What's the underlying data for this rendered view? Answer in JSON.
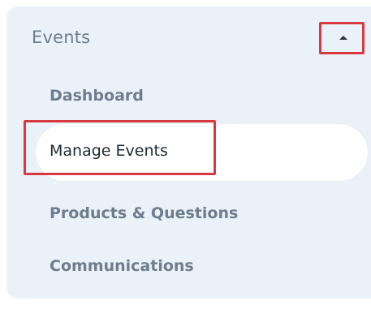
{
  "section": {
    "title": "Events",
    "toggle_icon": "caret-up-icon"
  },
  "nav": {
    "items": [
      {
        "label": "Dashboard",
        "active": false
      },
      {
        "label": "Manage Events",
        "active": true
      },
      {
        "label": "Products & Questions",
        "active": false
      },
      {
        "label": "Communications",
        "active": false
      }
    ]
  },
  "colors": {
    "panel_bg": "#eaf1f8",
    "highlight": "#d7393f",
    "inactive_text": "#6e7d8e",
    "active_text": "#1e2933",
    "active_bg": "#ffffff"
  }
}
